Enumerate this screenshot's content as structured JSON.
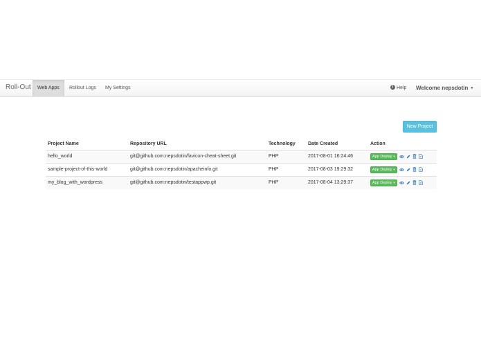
{
  "navbar": {
    "brand": "Roll-Out",
    "items": [
      {
        "label": "Web Apps",
        "active": true
      },
      {
        "label": "Rollout Logs",
        "active": false
      },
      {
        "label": "My Settings",
        "active": false
      }
    ],
    "help_label": "Help",
    "help_icon": "info-circle-icon",
    "welcome": "Welcome nepsdotin",
    "accent_active_bg": "#dddddd"
  },
  "toolbar": {
    "new_project_label": "New Project",
    "new_project_color": "#5bc0de"
  },
  "table": {
    "headers": [
      "Project Name",
      "Repository URL",
      "Technology",
      "Date Created",
      "Action"
    ],
    "rows": [
      {
        "name": "hello_world",
        "repo": "git@github.com:nepsdotin/favicon-cheat-sheet.git",
        "tech": "PHP",
        "date": "2017-08-01 16:24:46",
        "deploy_label": "App Deploy"
      },
      {
        "name": "sample-project-of-this-world",
        "repo": "git@github.com:nepsdotin/apacheinfo.git",
        "tech": "PHP",
        "date": "2017-08-03 19:29:32",
        "deploy_label": "App Deploy"
      },
      {
        "name": "my_blog_with_wordpress",
        "repo": "git@github.com:nepsdotin/testappwp.git",
        "tech": "PHP",
        "date": "2017-08-04 13:29:37",
        "deploy_label": "App Deploy"
      }
    ],
    "action_icons": [
      "eye-icon",
      "pencil-icon",
      "trash-icon",
      "document-icon"
    ],
    "deploy_color": "#5cb85c",
    "icon_color": "#337ab7"
  }
}
